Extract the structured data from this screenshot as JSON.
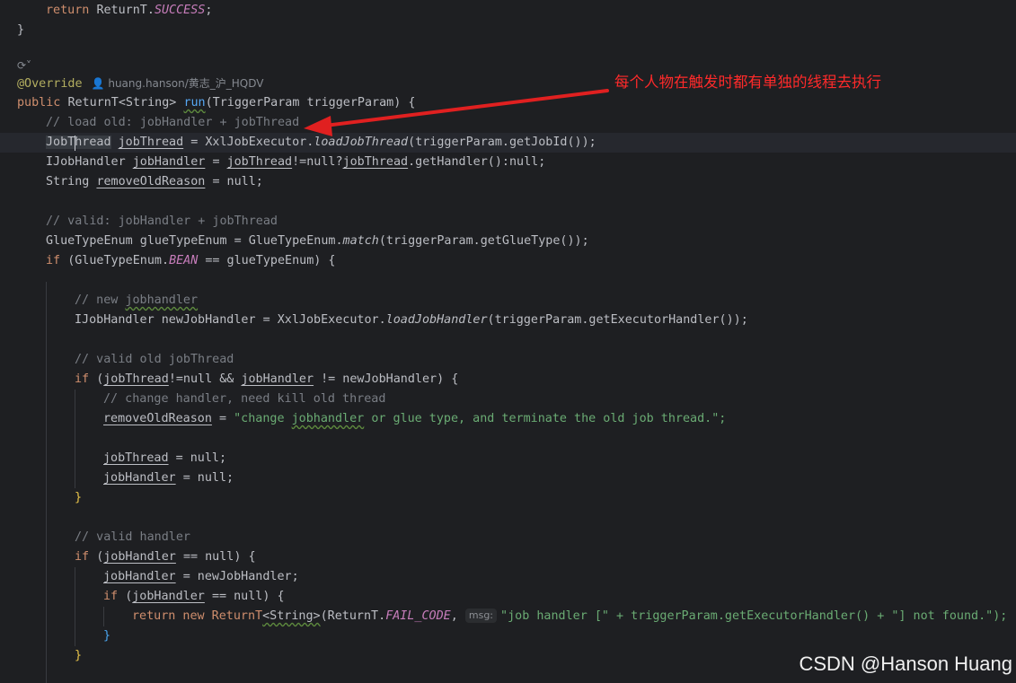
{
  "editor": {
    "author_inlay": "huang.hanson/黄志_沪_HQDV",
    "hint_label": "msg:",
    "lines": {
      "l1": [
        "return",
        "ReturnT.",
        "SUCCESS",
        ";"
      ],
      "l2": "}",
      "l4": "@Override",
      "l5": [
        "public",
        "ReturnT<String>",
        "run",
        "(TriggerParam triggerParam) {"
      ],
      "l6": "// load old: jobHandler + jobThread",
      "l7": [
        "JobThread",
        "jobThread",
        "= XxlJobExecutor.",
        "loadJobThread",
        "(triggerParam.getJobId());"
      ],
      "l8": [
        "IJobHandler",
        "jobHandler",
        "=",
        "jobThread",
        "!=null?",
        "jobThread",
        ".getHandler():null;"
      ],
      "l9": [
        "String",
        "removeOldReason",
        "= null;"
      ],
      "l11": "// valid: jobHandler + jobThread",
      "l12": [
        "GlueTypeEnum glueTypeEnum = GlueTypeEnum.",
        "match",
        "(triggerParam.getGlueType());"
      ],
      "l13": [
        "if",
        "(GlueTypeEnum.",
        "BEAN",
        "== glueTypeEnum) {"
      ],
      "l15": [
        "// new",
        "jobhandler"
      ],
      "l16": [
        "IJobHandler newJobHandler = XxlJobExecutor.",
        "loadJobHandler",
        "(triggerParam.getExecutorHandler());"
      ],
      "l18": "// valid old jobThread",
      "l19": [
        "if",
        "(",
        "jobThread",
        "!=null &&",
        "jobHandler",
        "!= newJobHandler) {"
      ],
      "l20": "// change handler, need kill old thread",
      "l21": [
        "removeOldReason",
        "=",
        "\"change",
        "jobhandler",
        "or glue type, and terminate the old job thread.\";"
      ],
      "l23": [
        "jobThread",
        "= null;"
      ],
      "l24": [
        "jobHandler",
        "= null;"
      ],
      "l25": "}",
      "l27": "// valid handler",
      "l28": [
        "if",
        "(",
        "jobHandler",
        "== null) {"
      ],
      "l29": [
        "jobHandler",
        "= newJobHandler;"
      ],
      "l30": [
        "if",
        "(",
        "jobHandler",
        "== null) {"
      ],
      "l31": [
        "return new ReturnT",
        "<String>",
        "(ReturnT.",
        "FAIL_CODE",
        ",",
        "\"job handler [\" + triggerParam.getExecutorHandler() + \"] not found.\");"
      ],
      "l32": "}",
      "l33": "}"
    }
  },
  "annotation": {
    "text": "每个人物在触发时都有单独的线程去执行",
    "color": "#ff2a2a"
  },
  "watermark": "CSDN @Hanson Huang",
  "colors": {
    "background": "#1e1f22",
    "keyword": "#cf8e6d",
    "comment": "#7a7e85",
    "string": "#6aab73",
    "constant": "#c77dbb",
    "method_call": "#56a8f5",
    "annotation": "#b3ae60"
  }
}
